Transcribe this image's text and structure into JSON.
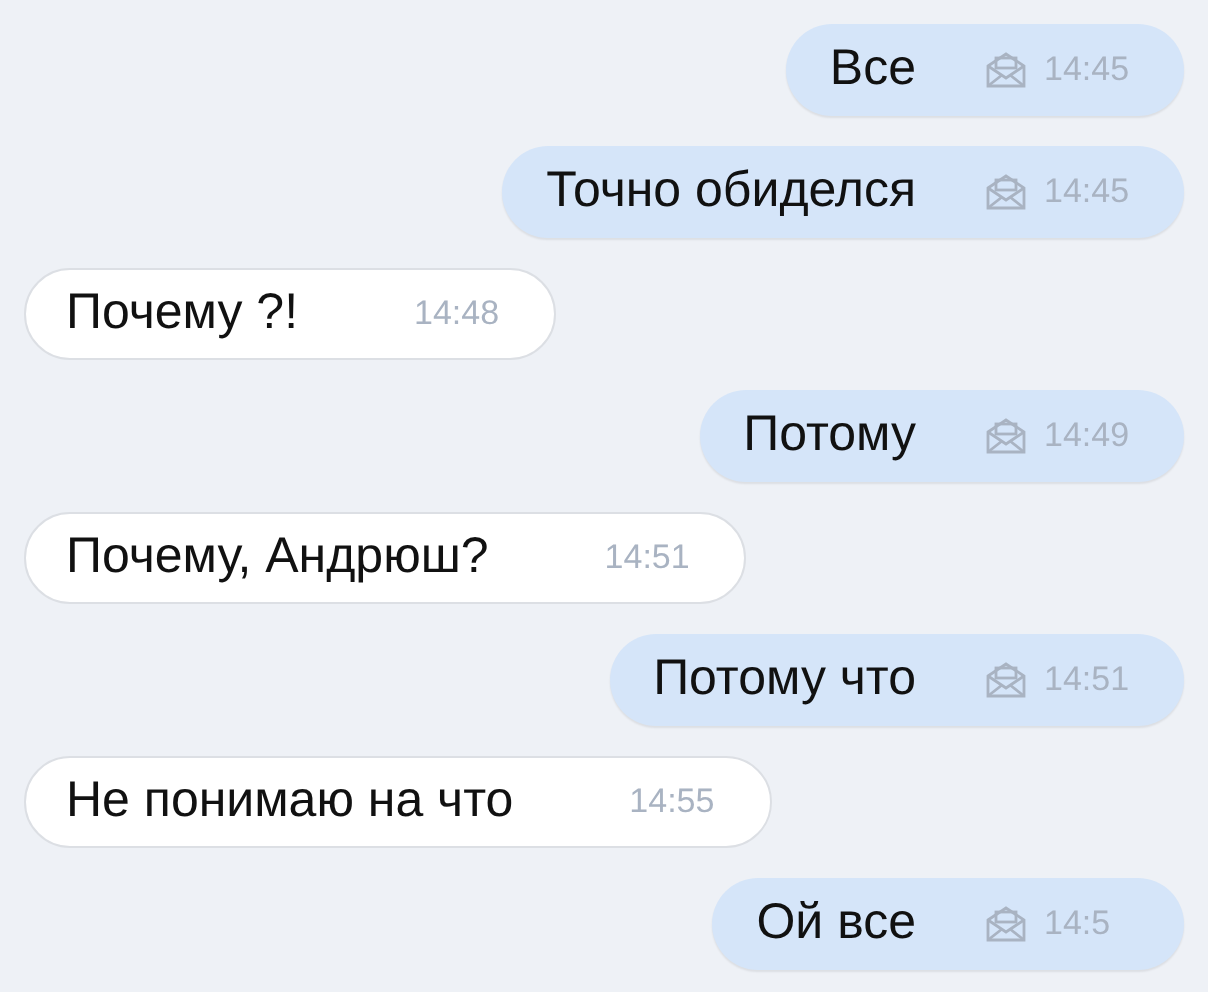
{
  "messages": [
    {
      "kind": "outgoing",
      "text": "Все",
      "time": "14:45"
    },
    {
      "kind": "outgoing",
      "text": "Точно обиделся",
      "time": "14:45"
    },
    {
      "kind": "incoming",
      "text": "Почему ?!",
      "time": "14:48"
    },
    {
      "kind": "outgoing",
      "text": "Потому",
      "time": "14:49"
    },
    {
      "kind": "incoming",
      "text": "Почему, Андрюш?",
      "time": "14:51"
    },
    {
      "kind": "outgoing",
      "text": "Потому что",
      "time": "14:51"
    },
    {
      "kind": "incoming",
      "text": "Не понимаю на что",
      "time": "14:55"
    },
    {
      "kind": "outgoing",
      "text": "Ой все",
      "time": "14:5"
    }
  ]
}
